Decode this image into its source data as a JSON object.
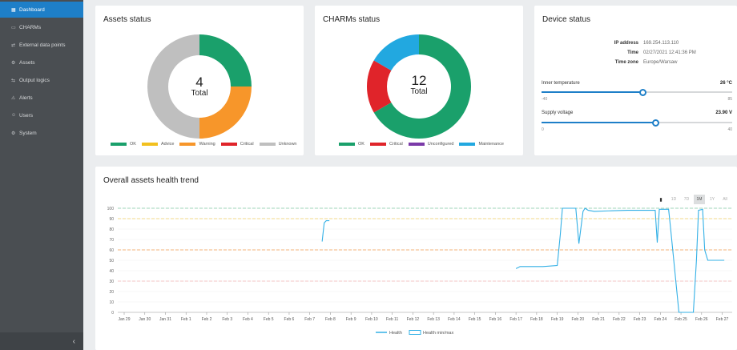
{
  "sidebar": {
    "items": [
      {
        "label": "Dashboard",
        "icon": "dashboard-icon",
        "glyph": "▦",
        "active": true
      },
      {
        "label": "CHARMs",
        "icon": "charm-icon",
        "glyph": "▭"
      },
      {
        "label": "External data points",
        "icon": "external-data-icon",
        "glyph": "⇄"
      },
      {
        "label": "Assets",
        "icon": "assets-icon",
        "glyph": "⚙"
      },
      {
        "label": "Output logics",
        "icon": "output-logics-icon",
        "glyph": "⇆"
      },
      {
        "label": "Alerts",
        "icon": "alert-icon",
        "glyph": "⚠"
      },
      {
        "label": "Users",
        "icon": "users-icon",
        "glyph": "☺"
      },
      {
        "label": "System",
        "icon": "system-icon",
        "glyph": "⚙"
      }
    ],
    "collapse_glyph": "‹"
  },
  "assets_status": {
    "title": "Assets status",
    "count": "4",
    "count_label": "Total",
    "legend": [
      {
        "label": "OK",
        "color": "#1aa06b"
      },
      {
        "label": "Advice",
        "color": "#f2c01e"
      },
      {
        "label": "Warning",
        "color": "#f7962a"
      },
      {
        "label": "Critical",
        "color": "#e0242a"
      },
      {
        "label": "Unknown",
        "color": "#bfbfbf"
      }
    ],
    "slices": [
      {
        "status": "OK",
        "value": 1,
        "color": "#1aa06b"
      },
      {
        "status": "Warning",
        "value": 1,
        "color": "#f7962a"
      },
      {
        "status": "Unknown",
        "value": 2,
        "color": "#bfbfbf"
      }
    ]
  },
  "charms_status": {
    "title": "CHARMs status",
    "count": "12",
    "count_label": "Total",
    "legend": [
      {
        "label": "OK",
        "color": "#1aa06b"
      },
      {
        "label": "Critical",
        "color": "#e0242a"
      },
      {
        "label": "Unconfigured",
        "color": "#7b3aa8"
      },
      {
        "label": "Maintenance",
        "color": "#22a8e0"
      }
    ],
    "slices": [
      {
        "status": "OK",
        "value": 8,
        "color": "#1aa06b"
      },
      {
        "status": "Critical",
        "value": 2,
        "color": "#e0242a"
      },
      {
        "status": "Maintenance",
        "value": 2,
        "color": "#22a8e0"
      }
    ]
  },
  "device_status": {
    "title": "Device status",
    "ip_label": "IP address",
    "ip_value": "169.254.113.110",
    "time_label": "Time",
    "time_value": "02/27/2021 12:41:36 PM",
    "tz_label": "Time zone",
    "tz_value": "Europe/Warsaw",
    "inner_temp": {
      "label": "Inner temperature",
      "value": "26 °C",
      "min": "-40",
      "max": "85",
      "level": 0.53
    },
    "supply_voltage": {
      "label": "Supply voltage",
      "value": "23.90 V",
      "min": "0",
      "max": "40",
      "level": 0.6
    }
  },
  "trend": {
    "title": "Overall assets health trend",
    "zoom": [
      {
        "label": "▮",
        "icon": "pause-icon"
      },
      {
        "label": "1D"
      },
      {
        "label": "7D"
      },
      {
        "label": "1M",
        "active": true
      },
      {
        "label": "1Y"
      },
      {
        "label": "All"
      }
    ],
    "legend": {
      "health": "Health",
      "minmax": "Health min/max"
    },
    "colors": {
      "line": "#33b0e6",
      "green_ref": "#9fd6b8",
      "yellow_ref": "#f3d98a",
      "orange_ref": "#f3b37a",
      "red_ref": "#f3c4c4"
    }
  },
  "chart_data": {
    "type": "line",
    "ylim": [
      0,
      100
    ],
    "yticks": [
      0,
      10,
      20,
      30,
      40,
      50,
      60,
      70,
      80,
      90,
      100
    ],
    "x_labels": [
      "Jan 29",
      "Jan 30",
      "Jan 31",
      "Feb 1",
      "Feb 2",
      "Feb 3",
      "Feb 4",
      "Feb 5",
      "Feb 6",
      "Feb 7",
      "Feb 8",
      "Feb 9",
      "Feb 10",
      "Feb 11",
      "Feb 12",
      "Feb 13",
      "Feb 14",
      "Feb 15",
      "Feb 16",
      "Feb 17",
      "Feb 18",
      "Feb 19",
      "Feb 20",
      "Feb 21",
      "Feb 22",
      "Feb 23",
      "Feb 24",
      "Feb 25",
      "Feb 26",
      "Feb 27"
    ],
    "reference_lines": [
      {
        "y": 100,
        "color": "#9fd6b8"
      },
      {
        "y": 90,
        "color": "#f3d98a"
      },
      {
        "y": 60,
        "color": "#f3b37a"
      },
      {
        "y": 30,
        "color": "#f3c4c4"
      }
    ],
    "series": [
      {
        "name": "Health",
        "segments": [
          [
            [
              9.6,
              68
            ],
            [
              9.7,
              86
            ],
            [
              9.8,
              88
            ],
            [
              9.95,
              88
            ]
          ],
          [
            [
              19.0,
              42
            ],
            [
              19.2,
              44
            ],
            [
              20.3,
              44
            ],
            [
              21.0,
              45
            ],
            [
              21.15,
              75
            ],
            [
              21.25,
              100
            ],
            [
              21.9,
              100
            ],
            [
              22.05,
              66
            ],
            [
              22.25,
              97
            ],
            [
              22.35,
              100
            ],
            [
              22.5,
              98
            ],
            [
              22.8,
              97
            ],
            [
              23.5,
              97.5
            ],
            [
              24.4,
              98
            ],
            [
              25.0,
              98
            ],
            [
              25.75,
              98
            ],
            [
              25.85,
              67
            ],
            [
              25.95,
              99
            ],
            [
              26.4,
              99
            ],
            [
              26.5,
              80
            ],
            [
              26.7,
              40
            ],
            [
              26.9,
              0
            ],
            [
              27.6,
              0
            ],
            [
              27.75,
              50
            ],
            [
              27.85,
              98
            ],
            [
              28.05,
              99
            ],
            [
              28.15,
              60
            ],
            [
              28.3,
              50
            ],
            [
              29.1,
              50
            ]
          ]
        ]
      }
    ]
  }
}
